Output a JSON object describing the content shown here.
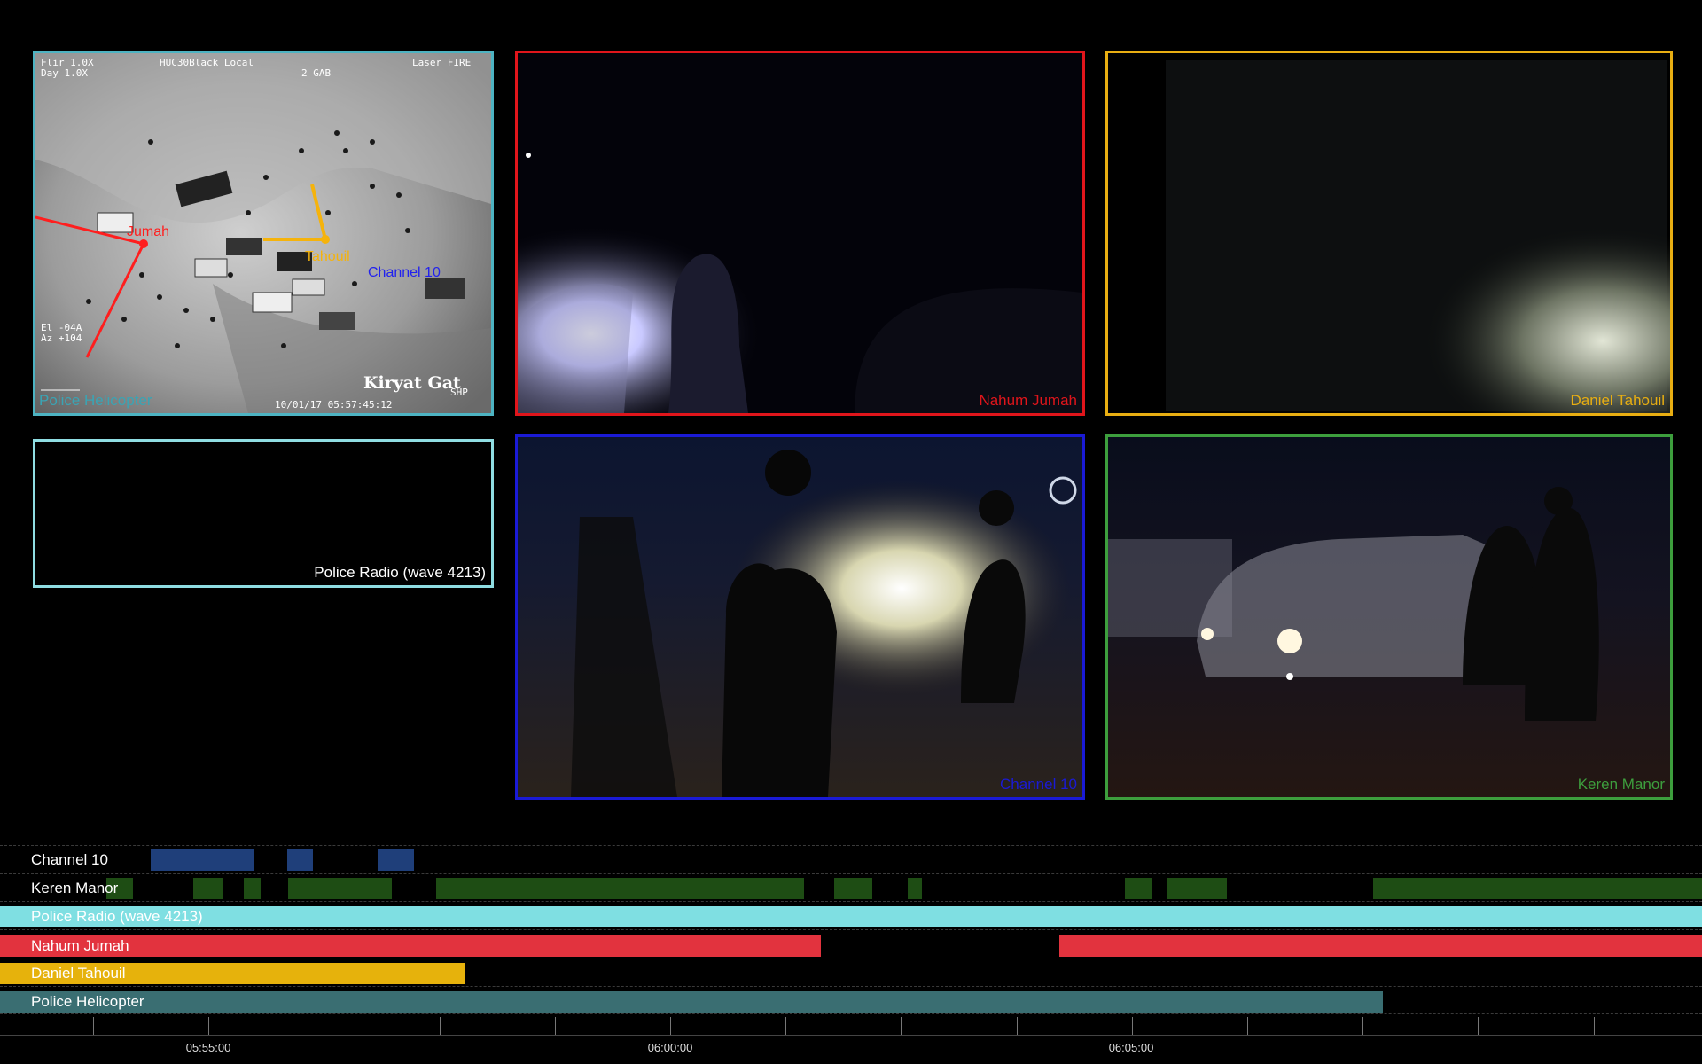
{
  "panels": {
    "helicopter": {
      "label": "Police Helicopter",
      "color": "#3aa4b4",
      "hud": {
        "top_left_1": "Flir  1.0X",
        "top_left_2": "Day   1.0X",
        "top_center": "HUC30Black Local",
        "top_right": "Laser FIRE",
        "top_center_2": "2 GAB",
        "left_1": "El -04A",
        "left_2": "Az +104",
        "location": "Kiryat Gat",
        "bottom_right": "SHP",
        "timestamp": "10/01/17 05:57:45:12"
      },
      "annotations": {
        "jumah": "Jumah",
        "tahouil": "Tahouil",
        "channel10": "Channel 10"
      }
    },
    "nahum": {
      "label": "Nahum Jumah",
      "color": "#e0151b"
    },
    "daniel": {
      "label": "Daniel Tahouil",
      "color": "#e8ae12"
    },
    "radio": {
      "label": "Police Radio (wave 4213)",
      "color": "#8fdde2"
    },
    "channel10": {
      "label": "Channel 10",
      "color": "#1a1ad6"
    },
    "keren": {
      "label": "Keren Manor",
      "color": "#3d9e3d"
    }
  },
  "timeline": {
    "tracks": [
      {
        "name": "Channel 10",
        "color": "#1f3f7a",
        "segments": [
          [
            170,
            287
          ],
          [
            324,
            353
          ],
          [
            426,
            467
          ]
        ]
      },
      {
        "name": "Keren Manor",
        "color": "#1e4d14",
        "segments": [
          [
            120,
            150
          ],
          [
            218,
            251
          ],
          [
            275,
            294
          ],
          [
            325,
            442
          ],
          [
            492,
            907
          ],
          [
            941,
            984
          ],
          [
            1024,
            1040
          ],
          [
            1269,
            1299
          ],
          [
            1316,
            1384
          ],
          [
            1549,
            1920
          ]
        ]
      },
      {
        "name": "Police Radio (wave 4213)",
        "color": "#7fdfe2",
        "segments": [
          [
            0,
            1920
          ]
        ]
      },
      {
        "name": "Nahum Jumah",
        "color": "#e2333e",
        "segments": [
          [
            0,
            926
          ],
          [
            1195,
            1920
          ]
        ]
      },
      {
        "name": "Daniel Tahouil",
        "color": "#e6b20c",
        "segments": [
          [
            0,
            525
          ]
        ]
      },
      {
        "name": "Police Helicopter",
        "color": "#3a6e72",
        "segments": [
          [
            0,
            1560
          ]
        ]
      }
    ],
    "axis_labels": [
      "05:55:00",
      "06:00:00",
      "06:05:00"
    ]
  }
}
